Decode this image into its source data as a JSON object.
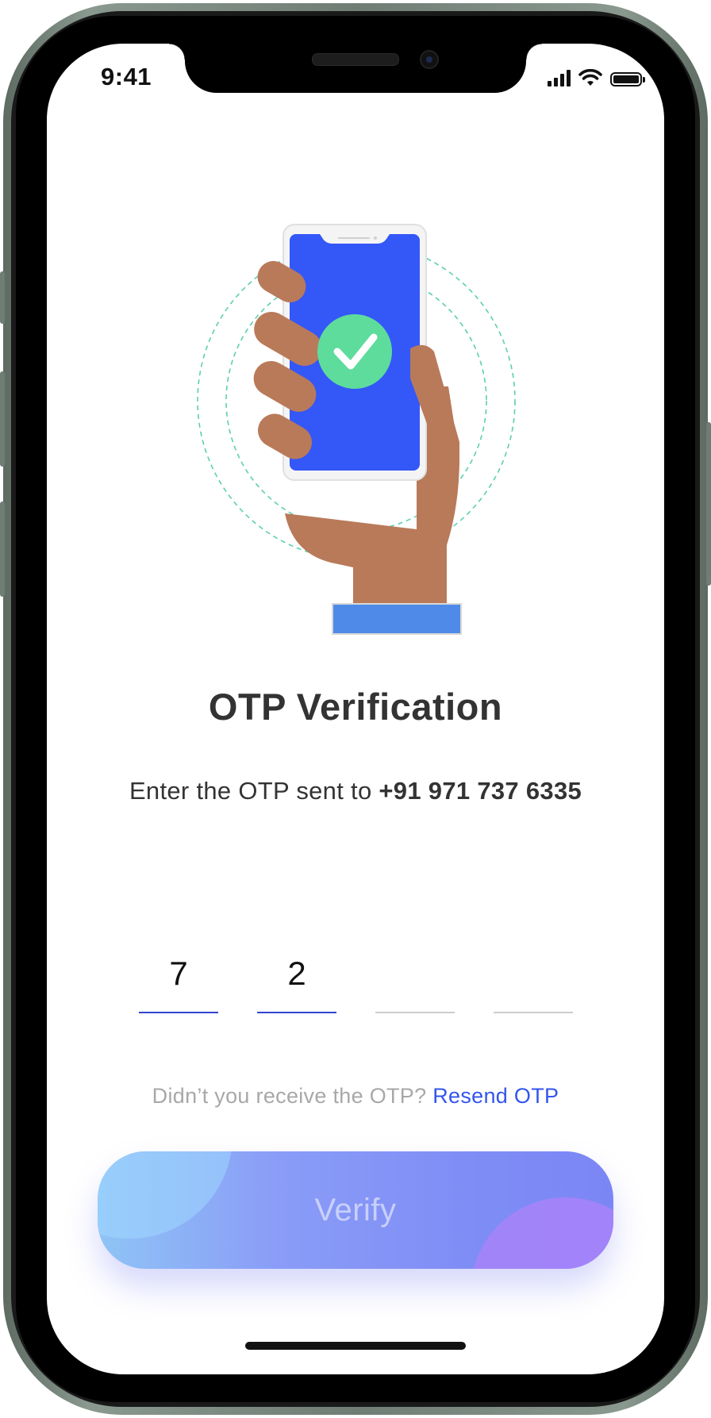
{
  "status_bar": {
    "time": "9:41"
  },
  "header": {
    "title": "OTP Verification",
    "subtitle_prefix": "Enter the OTP sent to ",
    "phone_number": "+91 971 737 6335"
  },
  "otp": {
    "digits": [
      "7",
      "2",
      "",
      ""
    ]
  },
  "resend": {
    "prompt": "Didn’t you receive the OTP? ",
    "link_label": "Resend OTP"
  },
  "verify_button": {
    "label": "Verify"
  },
  "colors": {
    "accent": "#3355ee",
    "illustration_phone_screen": "#3457f7",
    "illustration_check": "#5ddc9c",
    "illustration_skin": "#b97a5a",
    "illustration_sleeve": "#4f8ae8",
    "button_gradient_start": "#8fc4f5",
    "button_gradient_end": "#7b86f5"
  },
  "icons": {
    "illustration": "phone-verified-icon",
    "check": "check-icon",
    "signal": "signal-icon",
    "wifi": "wifi-icon",
    "battery": "battery-icon"
  }
}
